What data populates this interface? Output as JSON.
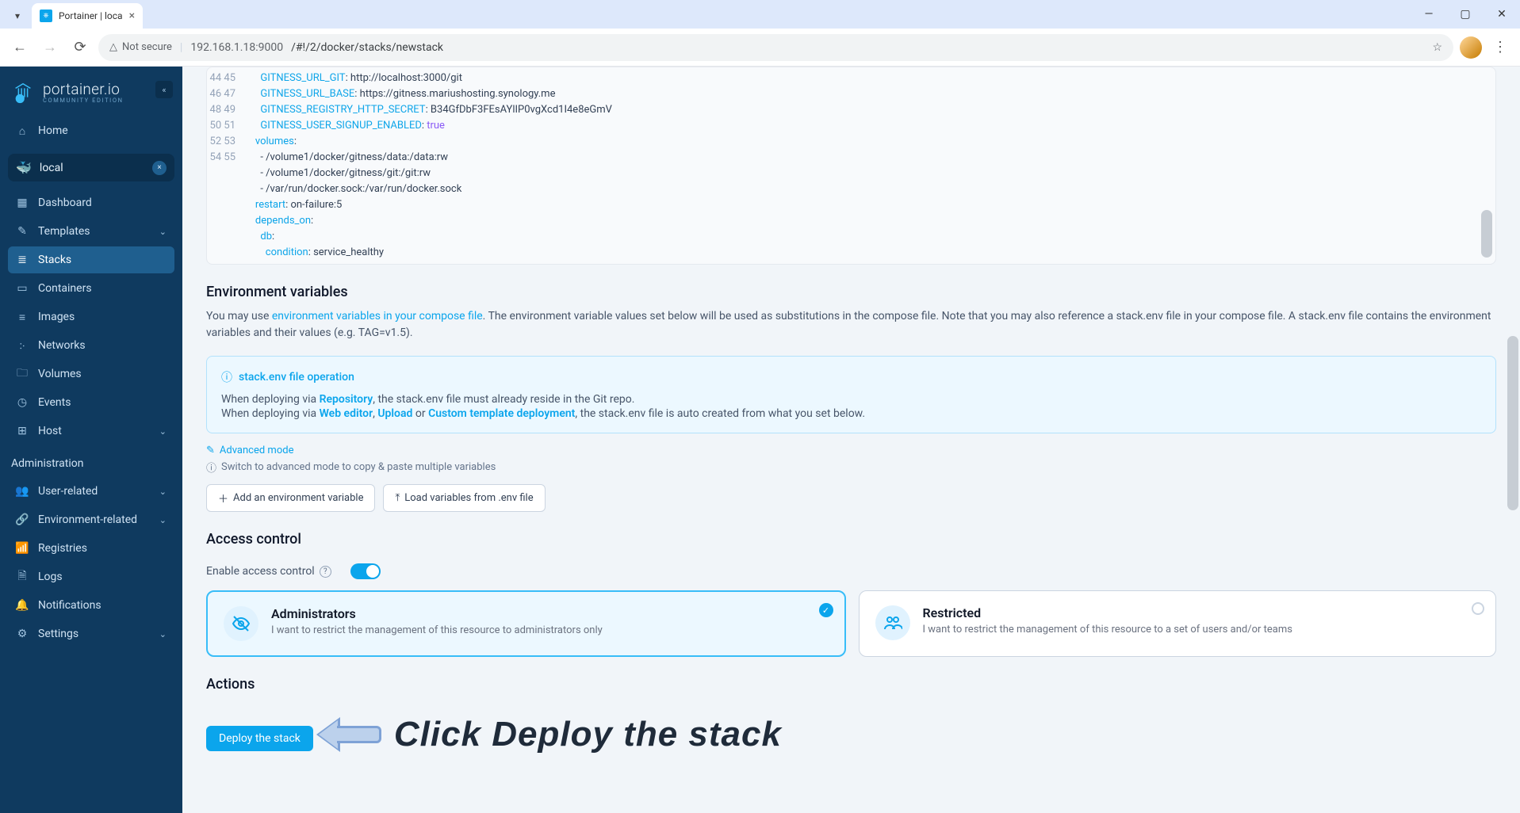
{
  "browser": {
    "tab_title": "Portainer | loca",
    "security_label": "Not secure",
    "url_host": "192.168.1.18:9000",
    "url_path": "/#!/2/docker/stacks/newstack"
  },
  "brand": {
    "name": "portainer.io",
    "sub": "COMMUNITY EDITION"
  },
  "nav": {
    "home": "Home",
    "env": "local",
    "items": [
      "Dashboard",
      "Templates",
      "Stacks",
      "Containers",
      "Images",
      "Networks",
      "Volumes",
      "Events",
      "Host"
    ],
    "admin_label": "Administration",
    "admin_items": [
      "User-related",
      "Environment-related",
      "Registries",
      "Logs",
      "Notifications",
      "Settings"
    ]
  },
  "editor": {
    "start": 44,
    "lines": [
      "      GITNESS_URL_GIT: http://localhost:3000/git",
      "      GITNESS_URL_BASE: https://gitness.mariushosting.synology.me",
      "      GITNESS_REGISTRY_HTTP_SECRET: B34GfDbF3FEsAYlIP0vgXcd1I4e8eGmV",
      "      GITNESS_USER_SIGNUP_ENABLED: true",
      "    volumes:",
      "      - /volume1/docker/gitness/data:/data:rw",
      "      - /volume1/docker/gitness/git:/git:rw",
      "      - /var/run/docker.sock:/var/run/docker.sock",
      "    restart: on-failure:5",
      "    depends_on:",
      "      db:",
      "        condition: service_healthy"
    ]
  },
  "env_section": {
    "title": "Environment variables",
    "help_pre": "You may use ",
    "help_link": "environment variables in your compose file",
    "help_post": ". The environment variable values set below will be used as substitutions in the compose file. Note that you may also reference a stack.env file in your compose file. A stack.env file contains the environment variables and their values (e.g. TAG=v1.5).",
    "info_title": "stack.env file operation",
    "info_l1_a": "When deploying via ",
    "info_l1_b": "Repository",
    "info_l1_c": ", the stack.env file must already reside in the Git repo.",
    "info_l2_a": "When deploying via ",
    "info_l2_b": "Web editor",
    "info_l2_c": ", ",
    "info_l2_d": "Upload",
    "info_l2_e": " or ",
    "info_l2_f": "Custom template deployment",
    "info_l2_g": ", the stack.env file is auto created from what you set below.",
    "adv_link": "Advanced mode",
    "adv_hint": "Switch to advanced mode to copy & paste multiple variables",
    "btn_add": "Add an environment variable",
    "btn_load": "Load variables from .env file"
  },
  "access": {
    "title": "Access control",
    "enable_label": "Enable access control",
    "card_admin_title": "Administrators",
    "card_admin_desc": "I want to restrict the management of this resource to administrators only",
    "card_restricted_title": "Restricted",
    "card_restricted_desc": "I want to restrict the management of this resource to a set of users and/or teams"
  },
  "actions": {
    "title": "Actions",
    "deploy": "Deploy the stack"
  },
  "annotation": "Click Deploy the stack"
}
